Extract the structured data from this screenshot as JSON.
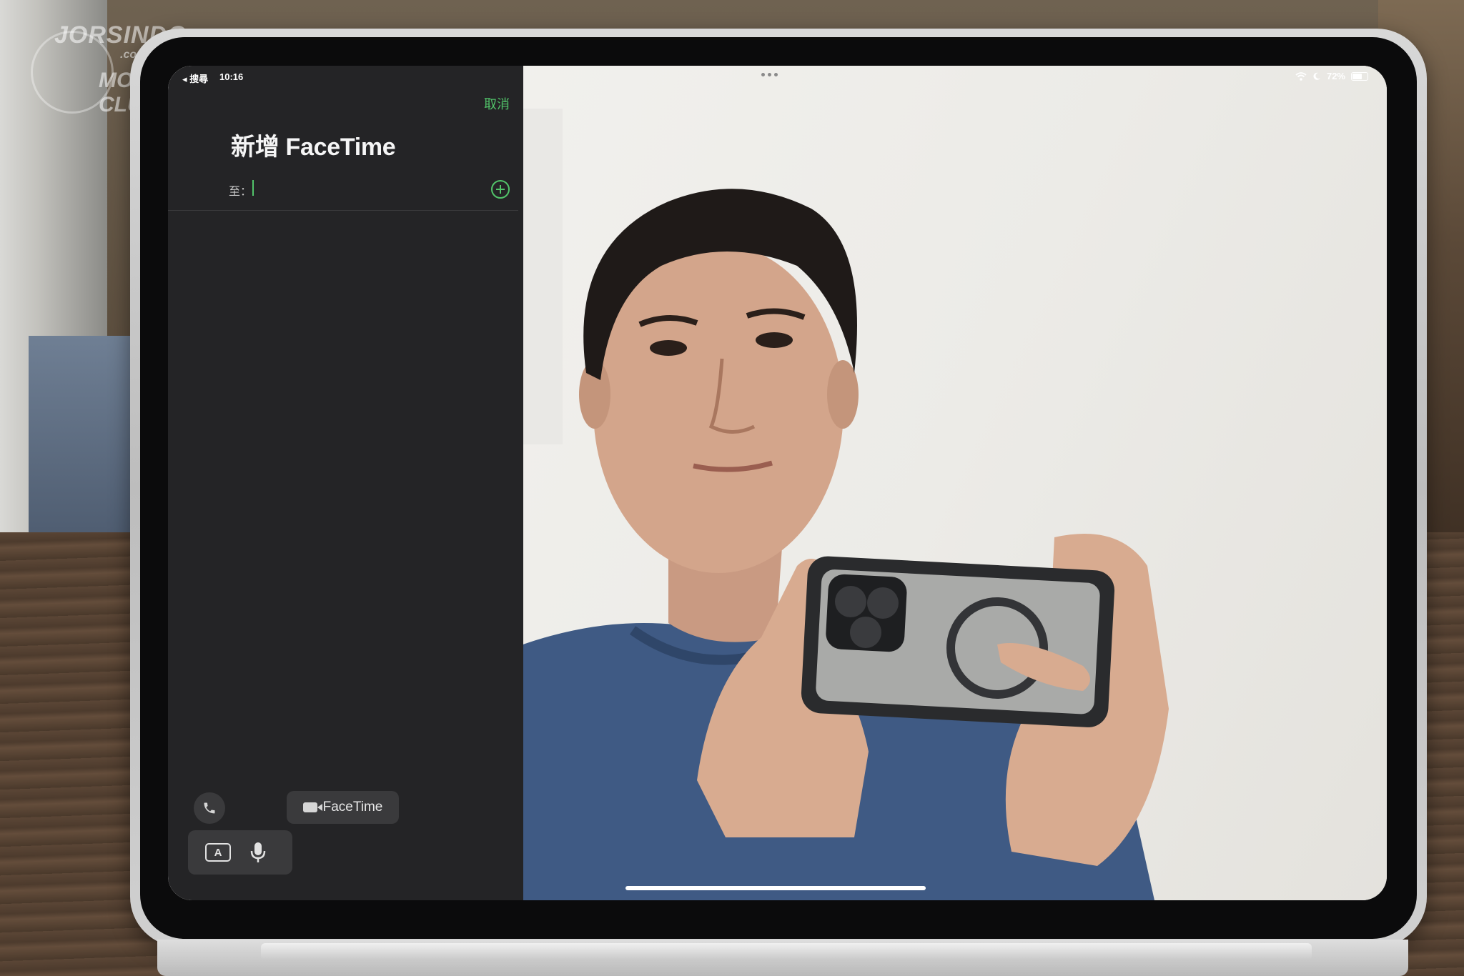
{
  "watermark": {
    "line1": "JORSINDO",
    "line2": ".com",
    "line3": "MOTOR CLUB"
  },
  "status_bar": {
    "back_app": "◂ 搜尋",
    "time": "10:16",
    "battery": "72%",
    "battery_level": 0.72,
    "icons": [
      "wifi-icon",
      "moon-icon",
      "battery-icon"
    ]
  },
  "new_facetime": {
    "title": "新增 FaceTime",
    "cancel_label": "取消",
    "to_label": "至：",
    "to_value": "",
    "add_contact_icon": "plus-circle-icon",
    "accent_color": "#52c46a"
  },
  "call_controls": {
    "audio_icon": "phone-icon",
    "facetime_label": "FaceTime",
    "facetime_icon": "video-camera-icon"
  },
  "keyboard_bar": {
    "keyboard_key": "A",
    "keyboard_icon": "keyboard-icon",
    "mic_icon": "microphone-icon"
  }
}
